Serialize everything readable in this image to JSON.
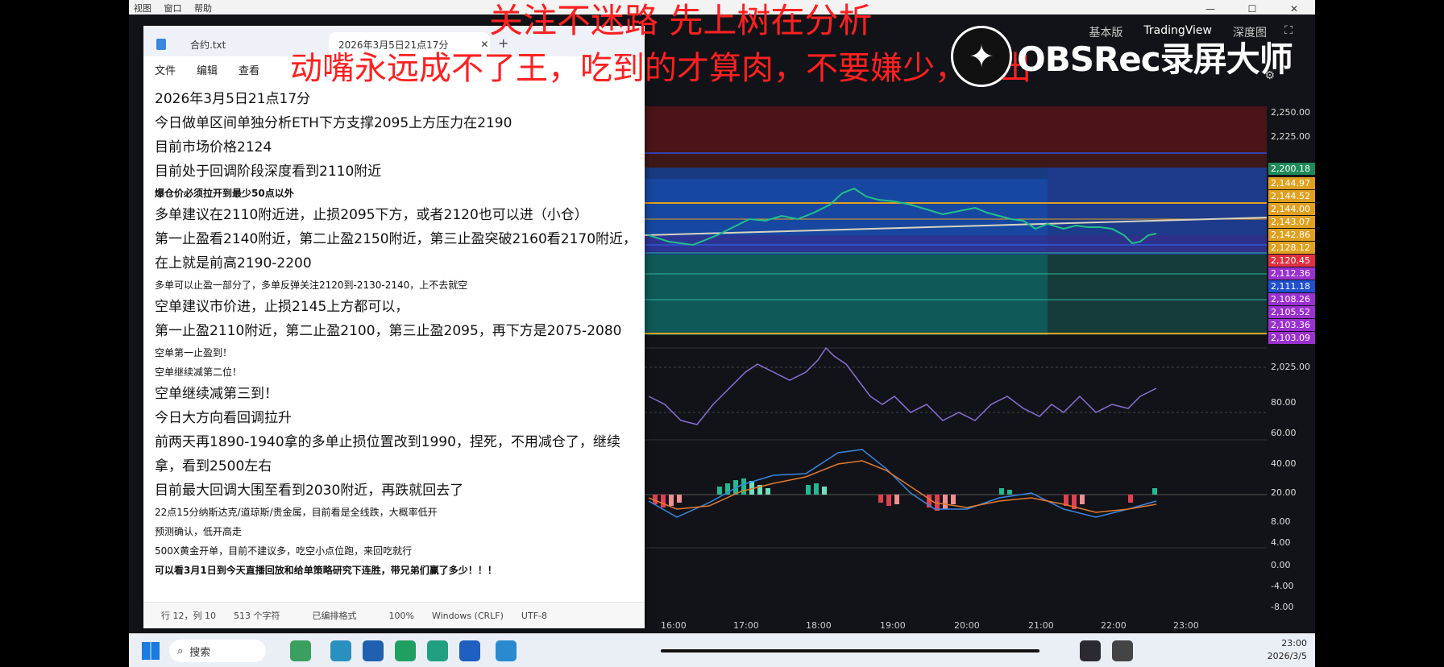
{
  "menu": {
    "items": [
      "视图",
      "窗口",
      "帮助"
    ]
  },
  "overlay": {
    "line1": "关注不迷路   先上树在分析",
    "line2": "动嘴永远成不了王，吃到的才算肉，不要嫌少，卖出",
    "obs_text": "OBSRec录屏大师"
  },
  "tradingview": {
    "tabs": [
      "基本版",
      "TradingView",
      "深度图"
    ]
  },
  "notepad": {
    "tab1": "合约.txt",
    "tab2": "2026年3月5日21点17分",
    "menus": [
      "文件",
      "编辑",
      "查看"
    ],
    "lines": [
      {
        "text": "2026年3月5日21点17分",
        "style": ""
      },
      {
        "text": "今日做单区间单独分析ETH下方支撑2095上方压力在2190",
        "style": ""
      },
      {
        "text": "目前市场价格2124",
        "style": ""
      },
      {
        "text": "目前处于回调阶段深度看到2110附近",
        "style": ""
      },
      {
        "text": "爆仓价必须拉开到最少50点以外",
        "style": "small bold"
      },
      {
        "text": "多单建议在2110附近进，止损2095下方，或者2120也可以进（小仓）",
        "style": ""
      },
      {
        "text": "第一止盈看2140附近，第二止盈2150附近，第三止盈突破2160看2170附近，",
        "style": ""
      },
      {
        "text": "在上就是前高2190-2200",
        "style": ""
      },
      {
        "text": "多单可以止盈一部分了，多单反弹关注2120到-2130-2140，上不去就空",
        "style": "small"
      },
      {
        "text": "空单建议市价进，止损2145上方都可以，",
        "style": ""
      },
      {
        "text": "第一止盈2110附近，第二止盈2100，第三止盈2095，再下方是2075-2080",
        "style": ""
      },
      {
        "text": "空单第一止盈到！",
        "style": "small"
      },
      {
        "text": "空单继续减第二位！",
        "style": "small"
      },
      {
        "text": "空单继续减第三到！",
        "style": ""
      },
      {
        "text": "今日大方向看回调拉升",
        "style": ""
      },
      {
        "text": "前两天再1890-1940拿的多单止损位置改到1990，捏死，不用减仓了，继续",
        "style": ""
      },
      {
        "text": "拿，看到2500左右",
        "style": ""
      },
      {
        "text": "目前最大回调大围至看到2030附近，再跌就回去了",
        "style": ""
      },
      {
        "text": "22点15分纳斯达克/道琼斯/贵金属，目前看是全线跌，大概率低开",
        "style": "small"
      },
      {
        "text": "预测确认，低开高走",
        "style": "small"
      },
      {
        "text": "500X黄金开单，目前不建议多，吃空小点位跑，来回吃就行",
        "style": "small"
      },
      {
        "text": "可以看3月1日到今天直播回放和给单策略研究下连胜，带兄弟们赢了多少！！！",
        "style": "small bold"
      }
    ],
    "status": {
      "position": "行 12，列 10",
      "chars": "513 个字符",
      "format": "已编排格式",
      "zoom": "100%",
      "eol": "Windows (CRLF)",
      "encoding": "UTF-8"
    }
  },
  "price_axis": [
    {
      "label": "2,250.00",
      "bg": ""
    },
    {
      "label": "2,225.00",
      "bg": ""
    },
    {
      "label": "2,200.18",
      "bg": "#1e8a5a"
    },
    {
      "label": "2,144.97",
      "bg": "#e0a020"
    },
    {
      "label": "2,144.52",
      "bg": "#e0a020"
    },
    {
      "label": "2,144.00",
      "bg": "#e0a020"
    },
    {
      "label": "2,143.07",
      "bg": "#e0a020"
    },
    {
      "label": "2,142.86",
      "bg": "#e0a020"
    },
    {
      "label": "2,128.12",
      "bg": "#e0a020"
    },
    {
      "label": "2,120.45",
      "bg": "#e03040"
    },
    {
      "label": "2,112.36",
      "bg": "#9b30d0"
    },
    {
      "label": "2,111.18",
      "bg": "#2050d0"
    },
    {
      "label": "2,108.26",
      "bg": "#9b30d0"
    },
    {
      "label": "2,105.52",
      "bg": "#9b30d0"
    },
    {
      "label": "2,103.36",
      "bg": "#9b30d0"
    },
    {
      "label": "2,103.09",
      "bg": "#9b30d0"
    },
    {
      "label": "2,025.00",
      "bg": ""
    }
  ],
  "rsi_axis": [
    "80.00",
    "60.00",
    "40.00",
    "20.00"
  ],
  "macd_axis": [
    "8.00",
    "4.00",
    "0.00",
    "-4.00",
    "-8.00"
  ],
  "time_axis": [
    "16:00",
    "17:00",
    "18:00",
    "19:00",
    "20:00",
    "21:00",
    "22:00",
    "23:00"
  ],
  "taskbar": {
    "search": "搜索",
    "time": "23:00",
    "date": "2026/3/5"
  }
}
